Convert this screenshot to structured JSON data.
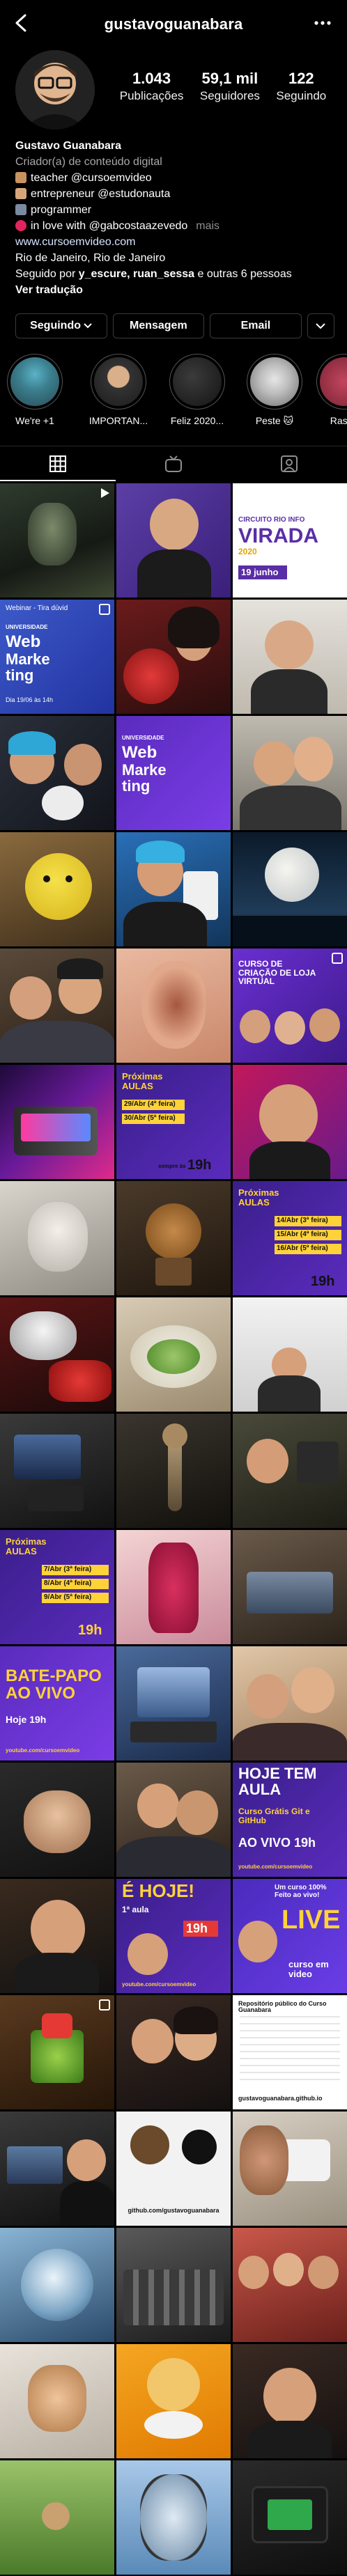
{
  "header": {
    "username": "gustavoguanabara"
  },
  "stats": [
    {
      "value": "1.043",
      "label": "Publicações"
    },
    {
      "value": "59,1 mil",
      "label": "Seguidores"
    },
    {
      "value": "122",
      "label": "Seguindo"
    }
  ],
  "bio": {
    "name": "Gustavo Guanabara",
    "category": "Criador(a) de conteúdo digital",
    "line1": "teacher @cursoemvideo",
    "line2": "entrepreneur @estudonauta",
    "line3": "programmer",
    "line4": "in love with @gabcostaazevedo",
    "more": "mais",
    "website": "www.cursoemvideo.com",
    "location": "Rio de Janeiro, Rio de Janeiro",
    "followed_prefix": "Seguido por ",
    "followed_names": "y_escure, ruan_sessa",
    "followed_suffix": " e outras 6 pessoas",
    "translate": "Ver tradução"
  },
  "actions": {
    "follow": "Seguindo",
    "message": "Mensagem",
    "email": "Email"
  },
  "highlights": [
    {
      "label": "We're +1"
    },
    {
      "label": "IMPORTAN..."
    },
    {
      "label": "Feliz 2020..."
    },
    {
      "label": "Peste 🐱"
    },
    {
      "label": "Raspb"
    }
  ],
  "posts": {
    "virada_title": "CIRCUITO RIO INFO",
    "virada_big": "VIRADA",
    "virada_year": "2020",
    "virada_date": "19 junho",
    "webinar_small": "Webinar - Tira dúvid",
    "webinar_uni": "UNIVERSIDADE",
    "webinar_web": "Web",
    "webinar_mkt": "Marke ting",
    "webinar_date": "Dia 19/06 às 14h",
    "uni_web": "Web",
    "uni_mkt": "Marke ting",
    "uni_label": "UNIVERSIDADE",
    "loja_title": "CURSO DE CRIAÇÃO DE LOJA VIRTUAL",
    "aulas1_title": "Próximas AULAS",
    "aulas1_line1": "29/Abr (4ª feira)",
    "aulas1_line2": "30/Abr (5ª feira)",
    "aulas1_time": "19h",
    "aulas2_title": "Próximas AULAS",
    "aulas2_line1": "14/Abr (3ª feira)",
    "aulas2_line2": "15/Abr (4ª feira)",
    "aulas2_line3": "16/Abr (5ª feira)",
    "aulas2_time": "19h",
    "aulas3_title": "Próximas AULAS",
    "aulas3_line1": "7/Abr (3ª feira)",
    "aulas3_line2": "8/Abr (4ª feira)",
    "aulas3_line3": "9/Abr (5ª feira)",
    "aulas3_time": "19h",
    "aulas_sempre": "sempre às",
    "batepapo_title": "BATE-PAPO AO VIVO",
    "batepapo_time": "Hoje 19h",
    "batepapo_url": "youtube.com/cursoemvideo",
    "hoje_title": "HOJE TEM AULA",
    "hoje_sub": "Curso Grátis Git e GitHub",
    "hoje_time": "AO VIVO 19h",
    "hoje_url": "youtube.com/cursoemvideo",
    "ehoje_title": "É HOJE!",
    "ehoje_sub": "1ª aula",
    "ehoje_time": "19h",
    "ehoje_url": "youtube.com/cursoemvideo",
    "live_top": "Um curso 100% Feito ao vivo!",
    "live_big": "LIVE",
    "live_brand": "curso em video",
    "doc_title": "Repositório público do Curso Guanabara",
    "doc_url": "gustavoguanabara.github.io",
    "gh_url": "github.com/gustavoguanabara"
  }
}
